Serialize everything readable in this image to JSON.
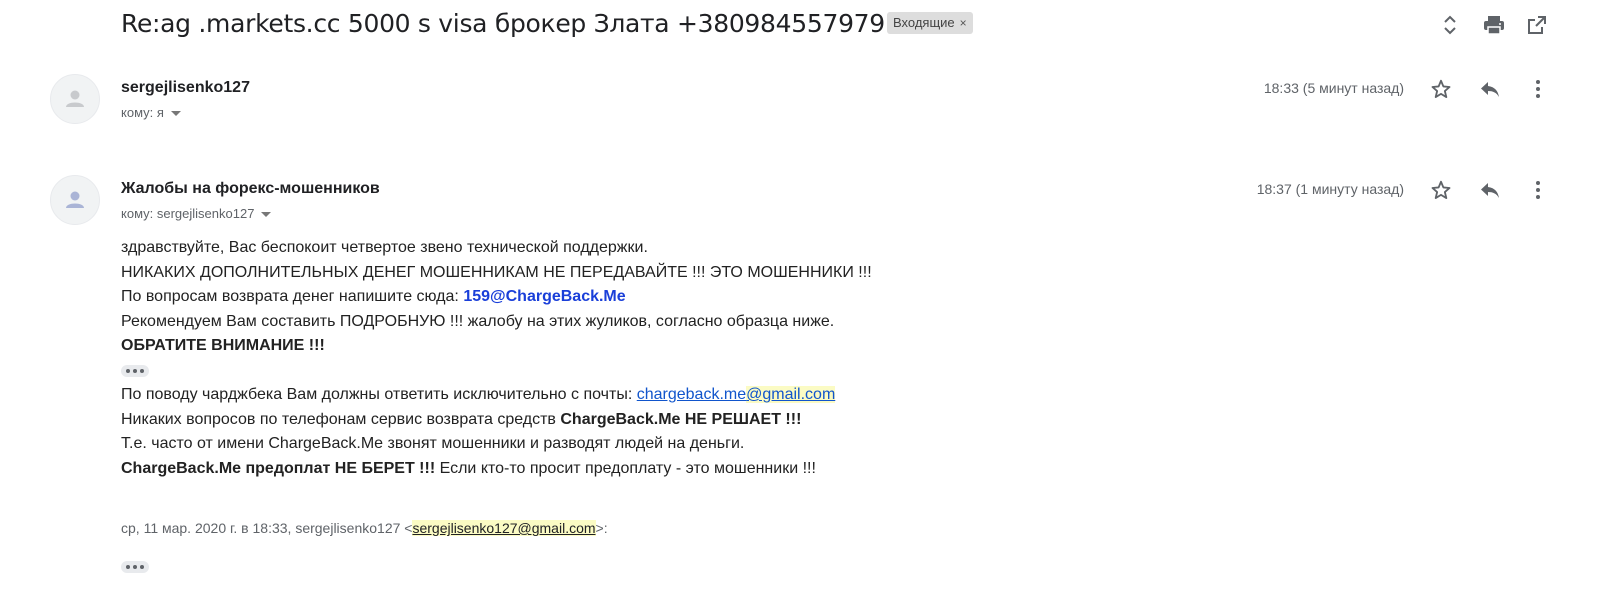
{
  "subject": "Re:ag .markets.cc 5000 s visa брокер Злата +380984557979",
  "label": {
    "text": "Входящие",
    "close": "×"
  },
  "top_icons": [
    "expand-collapse-icon",
    "print-icon",
    "open-in-new-window-icon"
  ],
  "messages": [
    {
      "sender": "sergejlisenko127",
      "to_prefix": "кому: я",
      "time": "18:33 (5 минут назад)"
    },
    {
      "sender": "Жалобы на форекс-мошенников",
      "to_prefix": "кому: sergejlisenko127",
      "time": "18:37 (1 минуту назад)"
    }
  ],
  "body": {
    "l1": "здравствуйте, Вас беспокоит четвертое звено технической поддержки.",
    "l2": "НИКАКИХ ДОПОЛНИТЕЛЬНЫХ ДЕНЕГ МОШЕННИКАМ НЕ ПЕРЕДАВАЙТЕ !!! ЭТО МОШЕННИКИ !!!",
    "l3_prefix": "По вопросам возврата денег напишите сюда: ",
    "l3_link": "159@ChargeBack.Me",
    "l4": "Рекомендуем Вам составить ПОДРОБНУЮ !!! жалобу на этих жуликов, согласно образца ниже.",
    "l5": "ОБРАТИТЕ ВНИМАНИЕ !!!",
    "l6_prefix": "По поводу чарджбека Вам должны ответить исключительно с почты: ",
    "l6_link_a": "chargeback.me",
    "l6_link_b": "@gmail.com",
    "l7_prefix": "Никаких вопросов по телефонам сервис возврата средств ",
    "l7_bold": "ChargeBack.Me НЕ РЕШАЕТ !!!",
    "l8": "Т.е. часто от имени ChargeBack.Me звонят мошенники и разводят людей на деньги.",
    "l9_bold": "ChargeBack.Me предоплат НЕ БЕРЕТ !!!",
    "l9_rest": " Если кто-то просит предоплату - это мошенники !!!"
  },
  "quote": {
    "prefix": "ср, 11 мар. 2020 г. в 18:33, sergejlisenko127 <",
    "email": "sergejlisenko127@gmail.com",
    "suffix": ">:"
  }
}
